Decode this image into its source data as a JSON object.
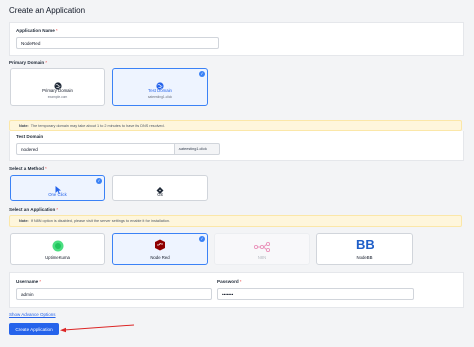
{
  "page": {
    "title": "Create an Application"
  },
  "app_name": {
    "label": "Application Name",
    "value": "NodeRed"
  },
  "primary_domain": {
    "label": "Primary Domain",
    "options": [
      {
        "title": "Primary Domain",
        "subtitle": "example.com",
        "selected": false
      },
      {
        "title": "Test Domain",
        "subtitle": "sateesting1.click",
        "selected": true
      }
    ]
  },
  "dns_note": {
    "prefix": "Note:",
    "text": "The temporary domain may take about 1 to 2 minutes to have its DNS resolved."
  },
  "test_domain": {
    "label": "Test Domain",
    "value": "nodered",
    "suffix": ".sateesting1.click"
  },
  "method": {
    "label": "Select a Method",
    "options": [
      {
        "title": "One Click",
        "icon": "cursor-click-icon",
        "selected": true
      },
      {
        "title": "Git",
        "icon": "git-icon",
        "selected": false
      }
    ]
  },
  "application": {
    "label": "Select an Application",
    "note": {
      "prefix": "Note:",
      "text": "If N8N option is disabled, please visit the server settings to enable it for installation."
    },
    "options": [
      {
        "title": "UptimeKuma",
        "icon": "uptime-kuma-icon",
        "selected": false,
        "disabled": false
      },
      {
        "title": "Node Red",
        "icon": "node-red-icon",
        "selected": true,
        "disabled": false
      },
      {
        "title": "N8N",
        "icon": "n8n-icon",
        "selected": false,
        "disabled": true
      },
      {
        "title": "NodeBB",
        "icon": "nodebb-icon",
        "selected": false,
        "disabled": false
      }
    ]
  },
  "credentials": {
    "username": {
      "label": "Username",
      "value": "admin"
    },
    "password": {
      "label": "Password",
      "value": "•••••••"
    }
  },
  "advance_link": "Show Advance Options",
  "submit_label": "Create Application",
  "colors": {
    "accent": "#2563eb",
    "note_bg": "#fef6dc",
    "arrow": "#dc2626"
  }
}
